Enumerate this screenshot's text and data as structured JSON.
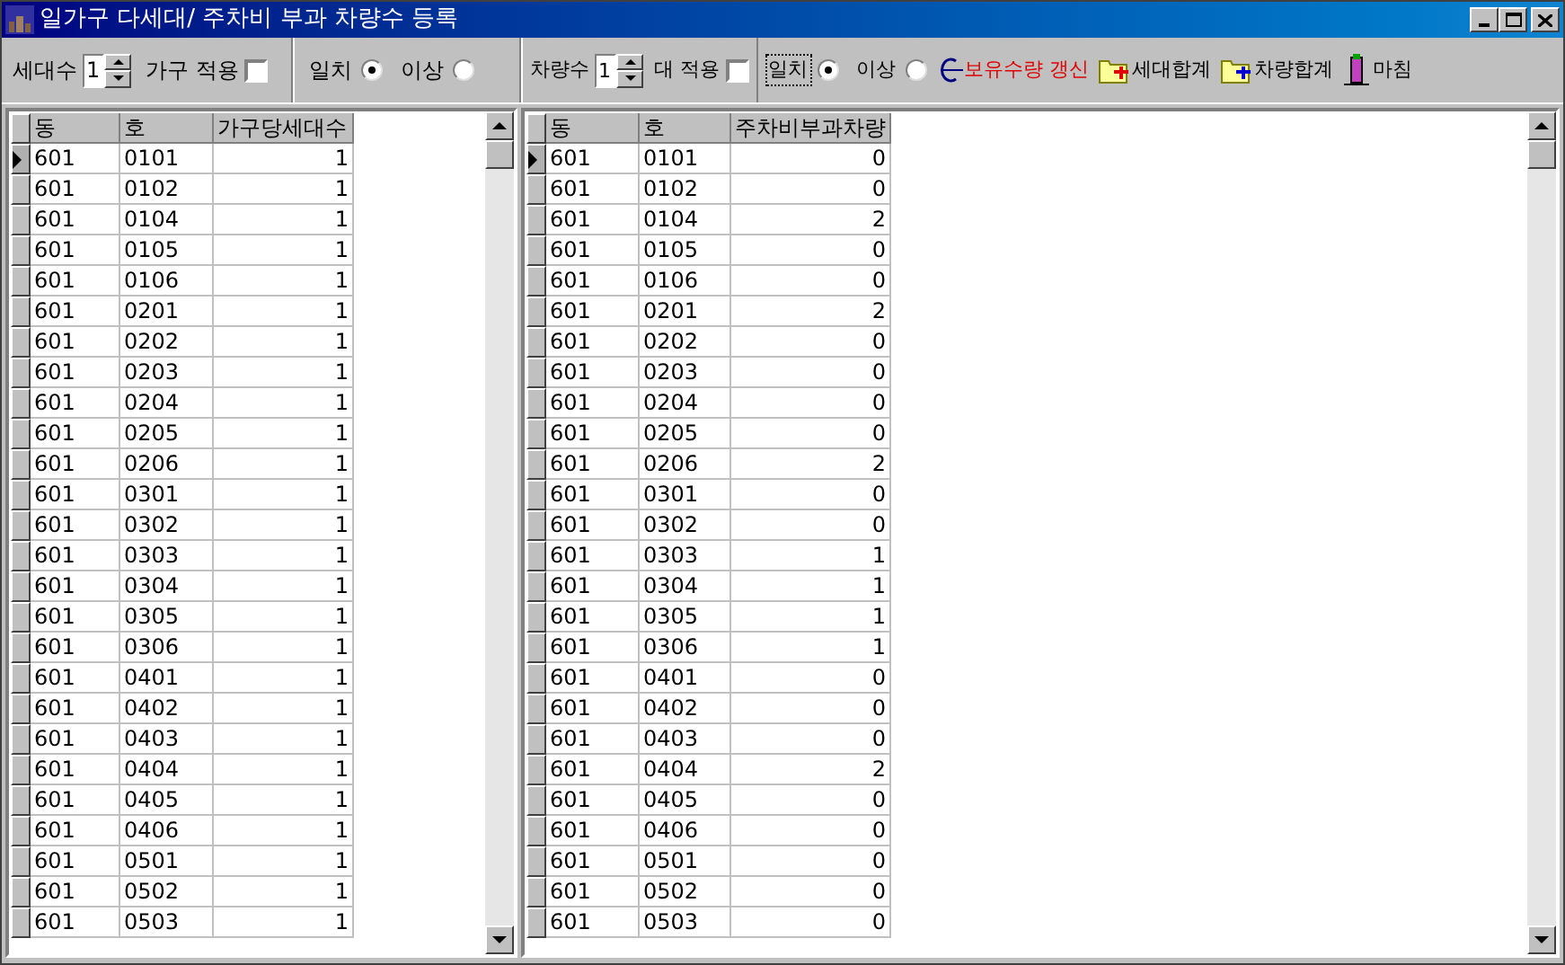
{
  "window": {
    "title": "일가구 다세대/ 주차비 부과 차량수 등록"
  },
  "toolbar_left": {
    "spinner": {
      "label": "세대수",
      "value": "1"
    },
    "checkbox": {
      "label": "가구 적용",
      "checked": false
    },
    "radios": [
      {
        "label": "일치",
        "selected": true,
        "focused": false
      },
      {
        "label": "이상",
        "selected": false,
        "focused": false
      }
    ]
  },
  "toolbar_right": {
    "spinner": {
      "label": "차량수",
      "value": "1"
    },
    "checkbox": {
      "label": "대 적용",
      "checked": false
    },
    "radios": [
      {
        "label": "일치",
        "selected": true,
        "focused": true
      },
      {
        "label": "이상",
        "selected": false,
        "focused": false
      }
    ],
    "buttons": [
      {
        "kind": "refresh",
        "label": "보유수량 갱신"
      },
      {
        "kind": "folder-red",
        "label": "세대합계"
      },
      {
        "kind": "folder-blue",
        "label": "차량합계"
      },
      {
        "kind": "exit",
        "label": "마침"
      }
    ]
  },
  "grid_left": {
    "columns": [
      "동",
      "호",
      "가구당세대수"
    ],
    "rows": [
      {
        "selected": true,
        "cells": [
          "601",
          "0101",
          "1"
        ]
      },
      {
        "selected": false,
        "cells": [
          "601",
          "0102",
          "1"
        ]
      },
      {
        "selected": false,
        "cells": [
          "601",
          "0104",
          "1"
        ]
      },
      {
        "selected": false,
        "cells": [
          "601",
          "0105",
          "1"
        ]
      },
      {
        "selected": false,
        "cells": [
          "601",
          "0106",
          "1"
        ]
      },
      {
        "selected": false,
        "cells": [
          "601",
          "0201",
          "1"
        ]
      },
      {
        "selected": false,
        "cells": [
          "601",
          "0202",
          "1"
        ]
      },
      {
        "selected": false,
        "cells": [
          "601",
          "0203",
          "1"
        ]
      },
      {
        "selected": false,
        "cells": [
          "601",
          "0204",
          "1"
        ]
      },
      {
        "selected": false,
        "cells": [
          "601",
          "0205",
          "1"
        ]
      },
      {
        "selected": false,
        "cells": [
          "601",
          "0206",
          "1"
        ]
      },
      {
        "selected": false,
        "cells": [
          "601",
          "0301",
          "1"
        ]
      },
      {
        "selected": false,
        "cells": [
          "601",
          "0302",
          "1"
        ]
      },
      {
        "selected": false,
        "cells": [
          "601",
          "0303",
          "1"
        ]
      },
      {
        "selected": false,
        "cells": [
          "601",
          "0304",
          "1"
        ]
      },
      {
        "selected": false,
        "cells": [
          "601",
          "0305",
          "1"
        ]
      },
      {
        "selected": false,
        "cells": [
          "601",
          "0306",
          "1"
        ]
      },
      {
        "selected": false,
        "cells": [
          "601",
          "0401",
          "1"
        ]
      },
      {
        "selected": false,
        "cells": [
          "601",
          "0402",
          "1"
        ]
      },
      {
        "selected": false,
        "cells": [
          "601",
          "0403",
          "1"
        ]
      },
      {
        "selected": false,
        "cells": [
          "601",
          "0404",
          "1"
        ]
      },
      {
        "selected": false,
        "cells": [
          "601",
          "0405",
          "1"
        ]
      },
      {
        "selected": false,
        "cells": [
          "601",
          "0406",
          "1"
        ]
      },
      {
        "selected": false,
        "cells": [
          "601",
          "0501",
          "1"
        ]
      },
      {
        "selected": false,
        "cells": [
          "601",
          "0502",
          "1"
        ]
      },
      {
        "selected": false,
        "cells": [
          "601",
          "0503",
          "1"
        ]
      }
    ]
  },
  "grid_right": {
    "columns": [
      "동",
      "호",
      "주차비부과차량"
    ],
    "rows": [
      {
        "selected": true,
        "cells": [
          "601",
          "0101",
          "0"
        ]
      },
      {
        "selected": false,
        "cells": [
          "601",
          "0102",
          "0"
        ]
      },
      {
        "selected": false,
        "cells": [
          "601",
          "0104",
          "2"
        ]
      },
      {
        "selected": false,
        "cells": [
          "601",
          "0105",
          "0"
        ]
      },
      {
        "selected": false,
        "cells": [
          "601",
          "0106",
          "0"
        ]
      },
      {
        "selected": false,
        "cells": [
          "601",
          "0201",
          "2"
        ]
      },
      {
        "selected": false,
        "cells": [
          "601",
          "0202",
          "0"
        ]
      },
      {
        "selected": false,
        "cells": [
          "601",
          "0203",
          "0"
        ]
      },
      {
        "selected": false,
        "cells": [
          "601",
          "0204",
          "0"
        ]
      },
      {
        "selected": false,
        "cells": [
          "601",
          "0205",
          "0"
        ]
      },
      {
        "selected": false,
        "cells": [
          "601",
          "0206",
          "2"
        ]
      },
      {
        "selected": false,
        "cells": [
          "601",
          "0301",
          "0"
        ]
      },
      {
        "selected": false,
        "cells": [
          "601",
          "0302",
          "0"
        ]
      },
      {
        "selected": false,
        "cells": [
          "601",
          "0303",
          "1"
        ]
      },
      {
        "selected": false,
        "cells": [
          "601",
          "0304",
          "1"
        ]
      },
      {
        "selected": false,
        "cells": [
          "601",
          "0305",
          "1"
        ]
      },
      {
        "selected": false,
        "cells": [
          "601",
          "0306",
          "1"
        ]
      },
      {
        "selected": false,
        "cells": [
          "601",
          "0401",
          "0"
        ]
      },
      {
        "selected": false,
        "cells": [
          "601",
          "0402",
          "0"
        ]
      },
      {
        "selected": false,
        "cells": [
          "601",
          "0403",
          "0"
        ]
      },
      {
        "selected": false,
        "cells": [
          "601",
          "0404",
          "2"
        ]
      },
      {
        "selected": false,
        "cells": [
          "601",
          "0405",
          "0"
        ]
      },
      {
        "selected": false,
        "cells": [
          "601",
          "0406",
          "0"
        ]
      },
      {
        "selected": false,
        "cells": [
          "601",
          "0501",
          "0"
        ]
      },
      {
        "selected": false,
        "cells": [
          "601",
          "0502",
          "0"
        ]
      },
      {
        "selected": false,
        "cells": [
          "601",
          "0503",
          "0"
        ]
      }
    ]
  }
}
